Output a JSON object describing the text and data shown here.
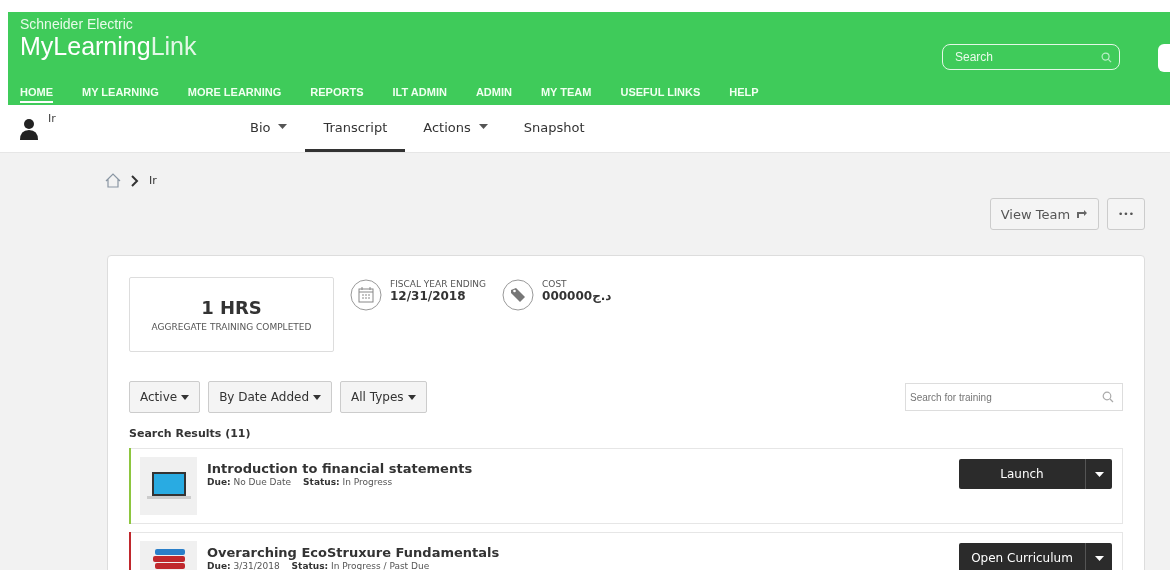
{
  "header": {
    "company": "Schneider Electric",
    "logo_bold": "MyLearning",
    "logo_light": "Link",
    "search": {
      "placeholder": "Search"
    },
    "nav": [
      {
        "label": "HOME",
        "selected": true
      },
      {
        "label": "MY LEARNING",
        "selected": false
      },
      {
        "label": "MORE LEARNING",
        "selected": false
      },
      {
        "label": "REPORTS",
        "selected": false
      },
      {
        "label": "ILT ADMIN",
        "selected": false
      },
      {
        "label": "ADMIN",
        "selected": false
      },
      {
        "label": "MY TEAM",
        "selected": false
      },
      {
        "label": "USEFUL LINKS",
        "selected": false
      },
      {
        "label": "HELP",
        "selected": false
      }
    ]
  },
  "user": {
    "name": "Ir"
  },
  "tabs": [
    {
      "label": "Bio",
      "dropdown": true,
      "selected": false
    },
    {
      "label": "Transcript",
      "dropdown": false,
      "selected": true
    },
    {
      "label": "Actions",
      "dropdown": true,
      "selected": false
    },
    {
      "label": "Snapshot",
      "dropdown": false,
      "selected": false
    }
  ],
  "breadcrumb": {
    "current": "Ir"
  },
  "view_team": "View Team",
  "more": "•••",
  "stats": {
    "hours": "1 HRS",
    "hours_label": "AGGREGATE TRAINING COMPLETED",
    "fiscal_label": "FISCAL YEAR ENDING",
    "fiscal_value": "12/31/2018",
    "cost_label": "COST",
    "cost_value": "000000د.ج"
  },
  "filters": [
    "Active",
    "By Date Added",
    "All Types"
  ],
  "training_search": {
    "placeholder": "Search for training"
  },
  "results_title": "Search Results (11)",
  "results": [
    {
      "kind": "course",
      "color": "#8dc63f",
      "title": "Introduction to financial statements",
      "due_label": "Due:",
      "due": "No Due Date",
      "status_label": "Status:",
      "status": "In Progress",
      "action": "Launch"
    },
    {
      "kind": "curriculum",
      "color": "#c0282d",
      "title": "Overarching EcoStruxure Fundamentals",
      "due_label": "Due:",
      "due": "3/31/2018",
      "status_label": "Status:",
      "status": "In Progress / Past Due",
      "action": "Open Curriculum"
    }
  ]
}
